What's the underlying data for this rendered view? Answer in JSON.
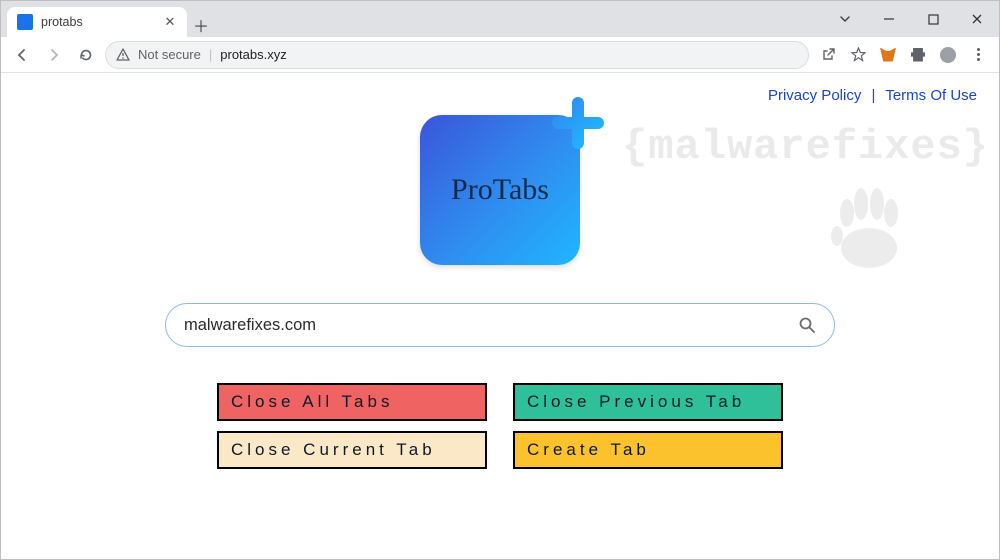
{
  "browser": {
    "tab_title": "protabs",
    "security_label": "Not secure",
    "url": "protabs.xyz"
  },
  "page": {
    "watermark": "{malwarefixes}",
    "links": {
      "privacy": "Privacy Policy",
      "terms": "Terms Of Use",
      "divider": "|"
    },
    "logo_text": "ProTabs",
    "search": {
      "value": "malwarefixes.com",
      "placeholder": ""
    },
    "buttons": [
      {
        "label": "Close All Tabs",
        "color": "c0"
      },
      {
        "label": "Close Previous Tab",
        "color": "c1"
      },
      {
        "label": "Close Current Tab",
        "color": "c2"
      },
      {
        "label": "Create Tab",
        "color": "c3"
      }
    ]
  }
}
